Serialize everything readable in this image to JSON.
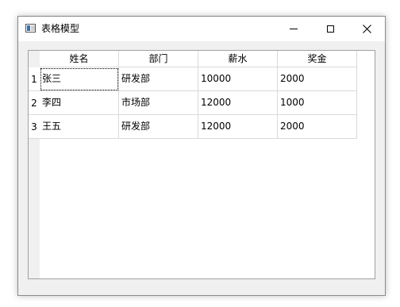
{
  "window": {
    "title": "表格模型"
  },
  "table": {
    "columns": [
      "姓名",
      "部门",
      "薪水",
      "奖金"
    ],
    "row_headers": [
      "1",
      "2",
      "3"
    ],
    "rows": [
      [
        "张三",
        "研发部",
        "10000",
        "2000"
      ],
      [
        "李四",
        "市场部",
        "12000",
        "1000"
      ],
      [
        "王五",
        "研发部",
        "12000",
        "2000"
      ]
    ],
    "focused_cell": "row1-col1"
  }
}
